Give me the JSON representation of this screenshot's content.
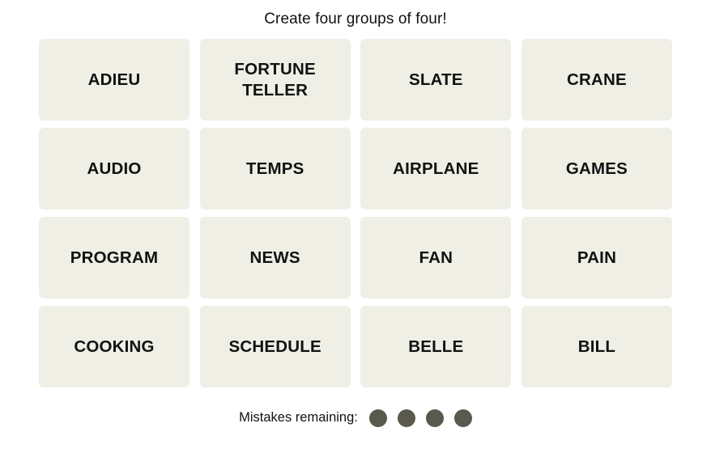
{
  "header": {
    "title": "Create four groups of four!"
  },
  "board": {
    "tiles": [
      {
        "label": "ADIEU"
      },
      {
        "label": "FORTUNE\nTELLER"
      },
      {
        "label": "SLATE"
      },
      {
        "label": "CRANE"
      },
      {
        "label": "AUDIO"
      },
      {
        "label": "TEMPS"
      },
      {
        "label": "AIRPLANE"
      },
      {
        "label": "GAMES"
      },
      {
        "label": "PROGRAM"
      },
      {
        "label": "NEWS"
      },
      {
        "label": "FAN"
      },
      {
        "label": "PAIN"
      },
      {
        "label": "COOKING"
      },
      {
        "label": "SCHEDULE"
      },
      {
        "label": "BELLE"
      },
      {
        "label": "BILL"
      }
    ],
    "tile_color": "#efefe6",
    "tile_text_color": "#121212"
  },
  "footer": {
    "mistakes_label": "Mistakes remaining:",
    "mistakes_remaining": 4,
    "dot_color": "#5a594e"
  }
}
